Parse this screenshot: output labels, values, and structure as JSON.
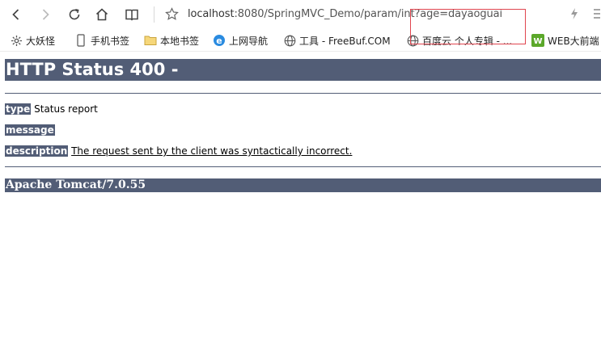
{
  "browser": {
    "url_host": "localhost",
    "url_rest": ":8080/SpringMVC_Demo/param/int?age=dayaoguai",
    "accent_highlight": "#e0454f",
    "bookmarks": [
      {
        "label": "大妖怪",
        "icon": "gear-icon"
      },
      {
        "label": "手机书签",
        "icon": "phone-icon"
      },
      {
        "label": "本地书签",
        "icon": "folder-icon"
      },
      {
        "label": "上网导航",
        "icon": "ie-icon"
      },
      {
        "label": "工具 - FreeBuf.COM",
        "icon": "globe-icon"
      },
      {
        "label": "百度云 个人专辑 - ...",
        "icon": "globe-icon"
      },
      {
        "label": "WEB大前端",
        "icon": "web-icon"
      }
    ]
  },
  "page": {
    "title": "HTTP Status 400 -",
    "type_label": "type",
    "type_value": "Status report",
    "message_label": "message",
    "message_value": "",
    "description_label": "description",
    "description_value": "The request sent by the client was syntactically incorrect.",
    "footer": "Apache Tomcat/7.0.55",
    "header_color": "#525d76"
  }
}
